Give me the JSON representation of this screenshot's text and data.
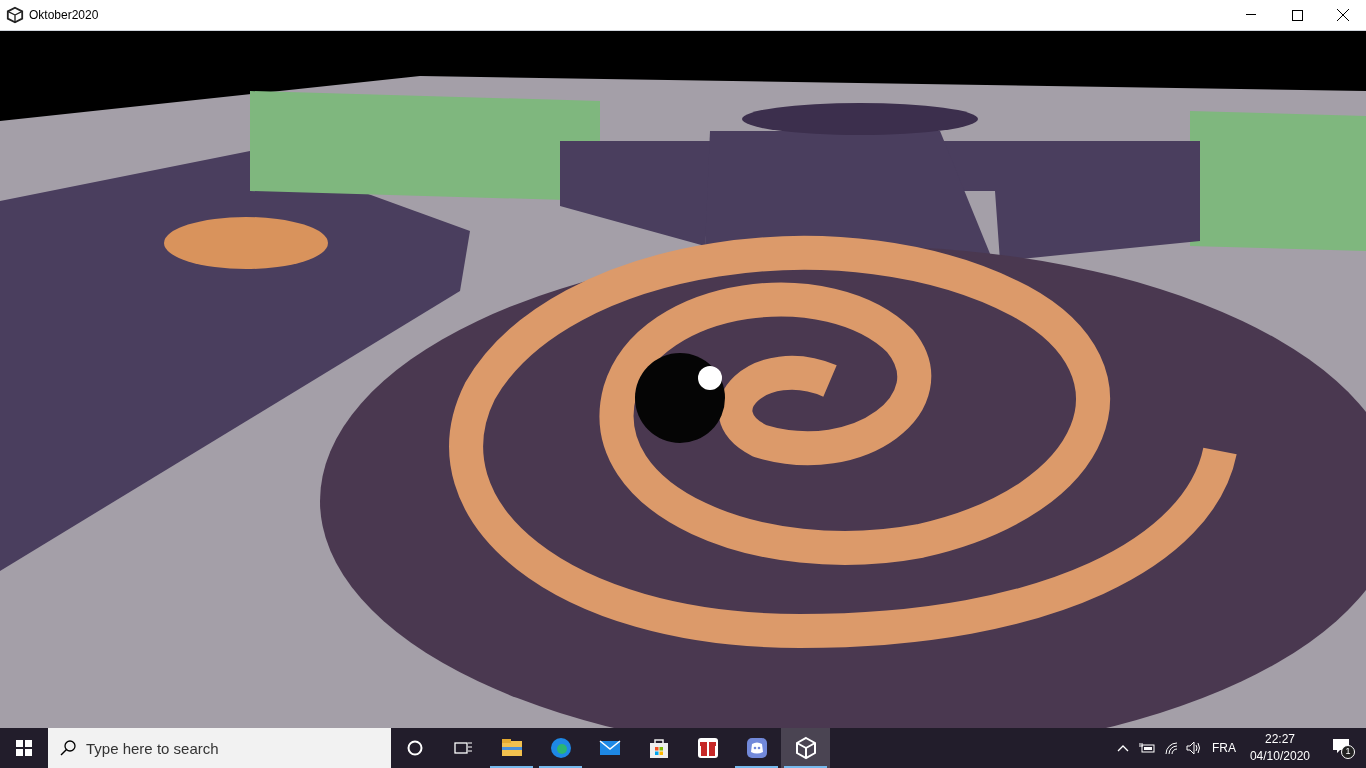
{
  "window": {
    "title": "Oktober2020"
  },
  "taskbar": {
    "search": {
      "placeholder": "Type here to search"
    },
    "apps": [
      {
        "kind": "explorer",
        "running": true,
        "selected": false
      },
      {
        "kind": "edge",
        "running": true,
        "selected": false
      },
      {
        "kind": "mail",
        "running": false,
        "selected": false
      },
      {
        "kind": "store",
        "running": false,
        "selected": false
      },
      {
        "kind": "gift",
        "running": false,
        "selected": false
      },
      {
        "kind": "discord",
        "running": true,
        "selected": false
      },
      {
        "kind": "unity",
        "running": true,
        "selected": true
      }
    ],
    "language": "FRA",
    "time": "22:27",
    "date": "04/10/2020",
    "notifications": "1"
  }
}
